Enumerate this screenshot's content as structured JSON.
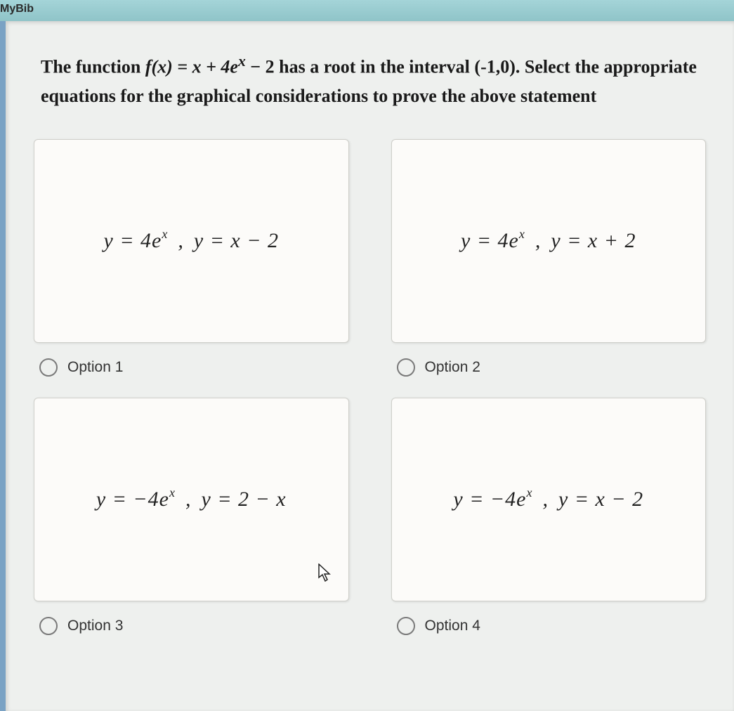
{
  "topbar": {
    "title": "MyBib"
  },
  "question": {
    "prefix": "The function  ",
    "func_label": "f(x)",
    "func_body": " = x + 4e",
    "func_exp": "x",
    "func_tail": " − 2  has a root in the interval (-1,0). Select the appropriate equations for the graphical considerations to prove the above statement"
  },
  "options": [
    {
      "eq1_lhs": "y = 4e",
      "eq1_exp": "x",
      "sep": ",",
      "eq2": "y = x − 2",
      "label": "Option 1"
    },
    {
      "eq1_lhs": "y = 4e",
      "eq1_exp": "x",
      "sep": ",",
      "eq2": "y = x + 2",
      "label": "Option 2"
    },
    {
      "eq1_lhs": "y = −4e",
      "eq1_exp": "x",
      "sep": ",",
      "eq2": "y = 2 − x",
      "label": "Option 3"
    },
    {
      "eq1_lhs": "y = −4e",
      "eq1_exp": "x",
      "sep": ",",
      "eq2": "y = x − 2",
      "label": "Option 4"
    }
  ]
}
